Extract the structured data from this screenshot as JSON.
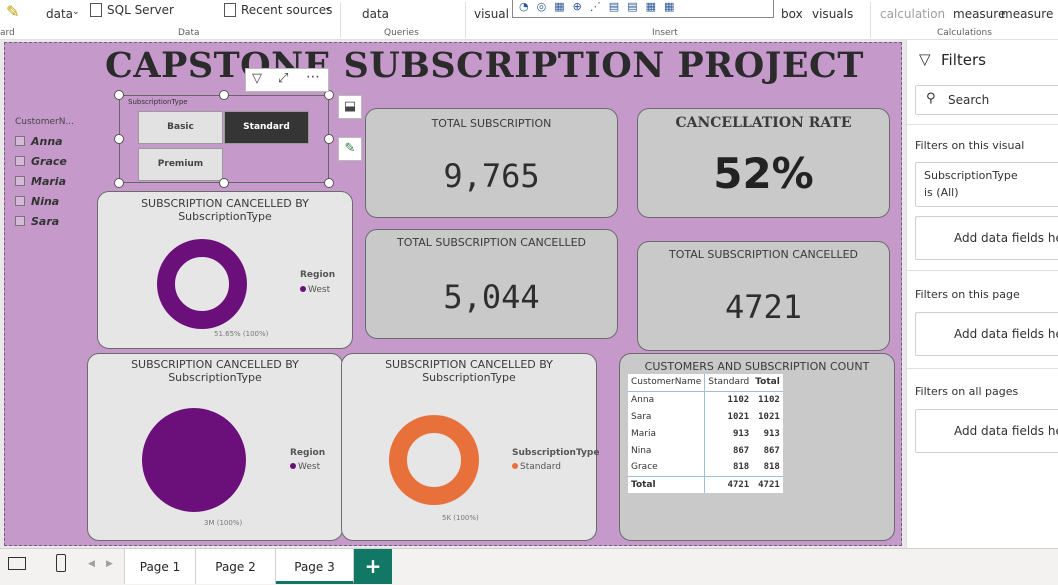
{
  "ribbon": {
    "get_data": "data",
    "sql_server": "SQL Server",
    "recent_sources": "Recent sources",
    "transform_data": "data",
    "new_visual": "visual",
    "text_box": "box",
    "more_visuals": "visuals",
    "new_calc": "calculation",
    "new_measure": "measure",
    "quick_measure": "measure",
    "groups": {
      "left": "ard",
      "data": "Data",
      "queries": "Queries",
      "insert": "Insert",
      "calculations": "Calculations"
    }
  },
  "report": {
    "title": "CAPSTONE SUBSCRIPTION PROJECT",
    "customer_slicer": {
      "header": "CustomerN...",
      "items": [
        "Anna",
        "Grace",
        "Maria",
        "Nina",
        "Sara"
      ]
    },
    "type_slicer": {
      "header": "SubscriptionType",
      "buttons": [
        "Basic",
        "Standard",
        "Premium"
      ],
      "selected": "Standard"
    },
    "cards": {
      "total_subscription": {
        "title": "TOTAL SUBSCRIPTION",
        "value": "9,765"
      },
      "cancellation_rate": {
        "title": "CANCELLATION RATE",
        "value": "52%"
      },
      "total_cancelled_1": {
        "title": "TOTAL SUBSCRIPTION CANCELLED",
        "value": "5,044"
      },
      "total_cancelled_2": {
        "title": "TOTAL SUBSCRIPTION CANCELLED",
        "value": "4721"
      }
    },
    "donut1": {
      "title_line1": "SUBSCRIPTION CANCELLED BY",
      "title_line2": "SubscriptionType",
      "legend_title": "Region",
      "legend_item": "West",
      "data_label": "51.65% (100%)",
      "color": "#6b0f7a"
    },
    "pie2": {
      "title_line1": "SUBSCRIPTION CANCELLED BY",
      "title_line2": "SubscriptionType",
      "legend_title": "Region",
      "legend_item": "West",
      "data_label": "3M (100%)",
      "color": "#6b0f7a"
    },
    "donut3": {
      "title_line1": "SUBSCRIPTION CANCELLED BY",
      "title_line2": "SubscriptionType",
      "legend_title": "SubscriptionType",
      "legend_item": "Standard",
      "data_label": "5K (100%)",
      "color": "#e8703a"
    },
    "matrix": {
      "title": "CUSTOMERS AND SUBSCRIPTION COUNT",
      "headers": [
        "CustomerName",
        "Standard",
        "Total"
      ],
      "rows": [
        [
          "Anna",
          "1102",
          "1102"
        ],
        [
          "Sara",
          "1021",
          "1021"
        ],
        [
          "Maria",
          "913",
          "913"
        ],
        [
          "Nina",
          "867",
          "867"
        ],
        [
          "Grace",
          "818",
          "818"
        ],
        [
          "Total",
          "4721",
          "4721"
        ]
      ]
    }
  },
  "filters_pane": {
    "title": "Filters",
    "search_placeholder": "Search",
    "on_visual": "Filters on this visual",
    "visual_filter_line1": "SubscriptionType",
    "visual_filter_line2": "is (All)",
    "add_fields": "Add data fields here",
    "on_page": "Filters on this page",
    "on_all": "Filters on all pages"
  },
  "tabs": [
    "Page 1",
    "Page 2",
    "Page 3"
  ],
  "active_tab": "Page 3",
  "add_page": "+"
}
